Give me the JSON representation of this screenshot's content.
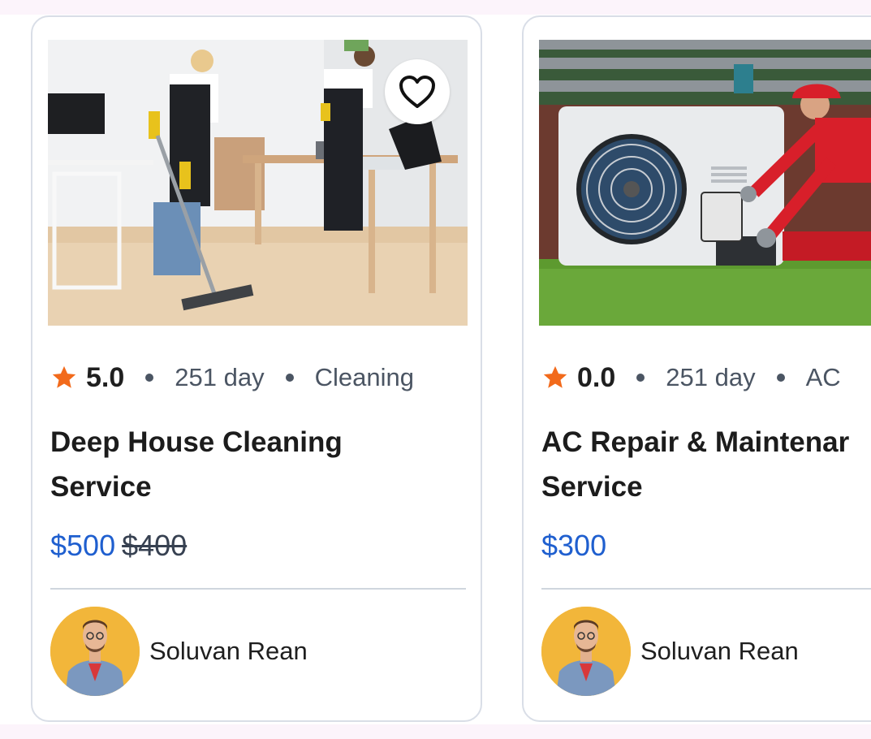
{
  "cards": [
    {
      "rating": "5.0",
      "duration": "251 day",
      "category": "Cleaning",
      "title_line1": "Deep House Cleaning",
      "title_line2": "Service",
      "price": "$500",
      "old_price": "$400",
      "provider": "Soluvan Rean",
      "image": "house-cleaning-photo",
      "favorite_icon": "heart-outline-icon"
    },
    {
      "rating": "0.0",
      "duration": "251 day",
      "category": "AC",
      "title_line1": "AC Repair & Maintenar",
      "title_line2": "Service",
      "price": "$300",
      "old_price": "",
      "provider": "Soluvan Rean",
      "image": "ac-repair-photo"
    }
  ],
  "colors": {
    "star": "#f26a1b",
    "price": "#1f5fcf",
    "border": "#d9dee7",
    "avatar_bg": "#f2b63a"
  }
}
